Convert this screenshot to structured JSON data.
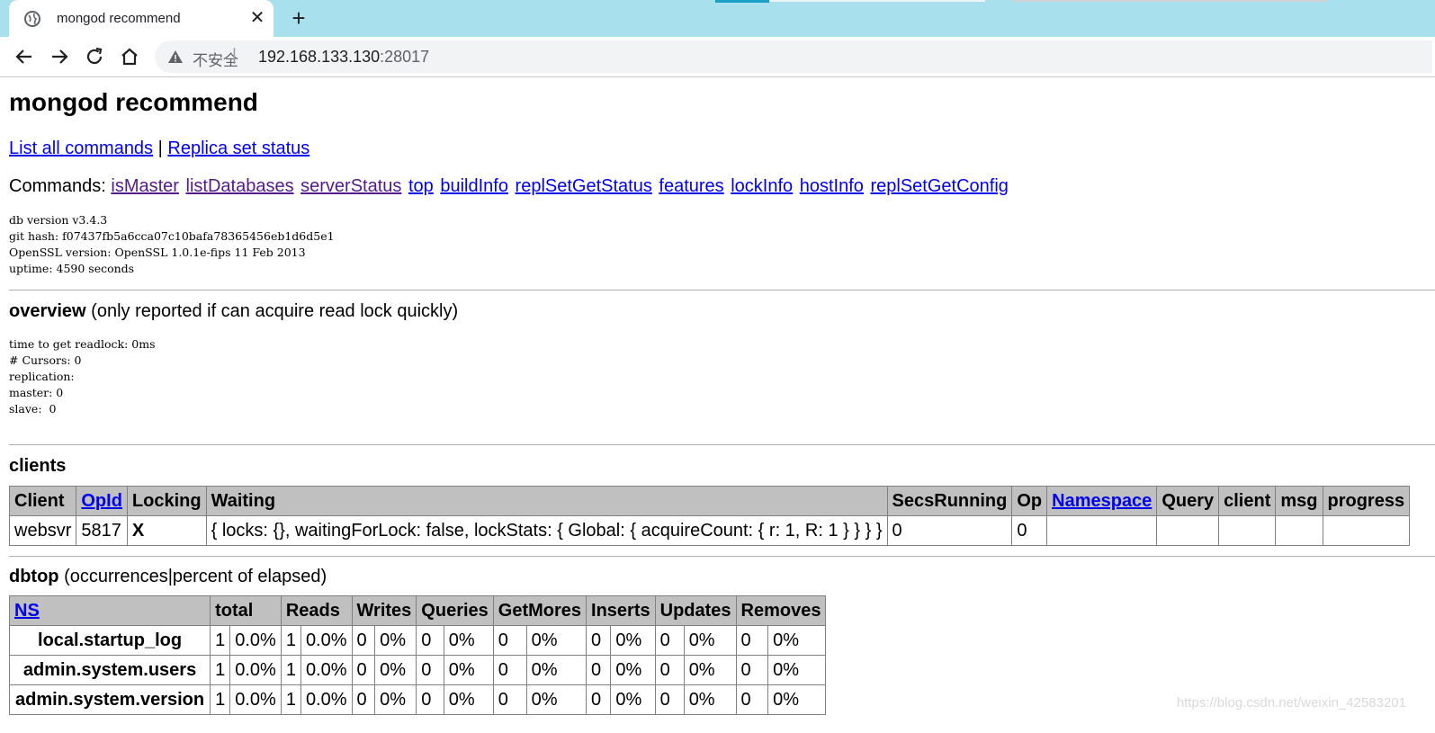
{
  "browser": {
    "tab_title": "mongod recommend",
    "new_tab_label": "+",
    "security_label": "不安全",
    "separator": "|",
    "url_host": "192.168.133.130",
    "url_port": ":28017"
  },
  "page": {
    "title": "mongod recommend",
    "nav": {
      "list_all_commands": "List all commands",
      "pipe": "|",
      "replica_set_status": "Replica set status"
    },
    "commands_label": "Commands:",
    "commands": [
      "isMaster",
      "listDatabases",
      "serverStatus",
      "top",
      "buildInfo",
      "replSetGetStatus",
      "features",
      "lockInfo",
      "hostInfo",
      "replSetGetConfig"
    ],
    "version_info": "db version v3.4.3\ngit hash: f07437fb5a6cca07c10bafa78365456eb1d6d5e1\nOpenSSL version: OpenSSL 1.0.1e-fips 11 Feb 2013\nuptime: 4590 seconds",
    "overview": {
      "title": "overview",
      "note": "(only reported if can acquire read lock quickly)",
      "details": "time to get readlock: 0ms\n# Cursors: 0\nreplication:\nmaster: 0\nslave:  0"
    },
    "clients": {
      "title": "clients",
      "headers": [
        "Client",
        "OpId",
        "Locking",
        "Waiting",
        "SecsRunning",
        "Op",
        "Namespace",
        "Query",
        "client",
        "msg",
        "progress"
      ],
      "rows": [
        [
          "websvr",
          "5817",
          "X",
          "{ locks: {}, waitingForLock: false, lockStats: { Global: { acquireCount: { r: 1, R: 1 } } } }",
          "0",
          "0",
          "",
          "",
          "",
          "",
          ""
        ]
      ]
    },
    "dbtop": {
      "title": "dbtop",
      "note": "(occurrences|percent of elapsed)",
      "headers": [
        "NS",
        "total",
        "Reads",
        "Writes",
        "Queries",
        "GetMores",
        "Inserts",
        "Updates",
        "Removes"
      ],
      "rows": [
        [
          "local.startup_log",
          "1",
          "0.0%",
          "1",
          "0.0%",
          "0",
          "0%",
          "0",
          "0%",
          "0",
          "0%",
          "0",
          "0%",
          "0",
          "0%",
          "0",
          "0%"
        ],
        [
          "admin.system.users",
          "1",
          "0.0%",
          "1",
          "0.0%",
          "0",
          "0%",
          "0",
          "0%",
          "0",
          "0%",
          "0",
          "0%",
          "0",
          "0%",
          "0",
          "0%"
        ],
        [
          "admin.system.version",
          "1",
          "0.0%",
          "1",
          "0.0%",
          "0",
          "0%",
          "0",
          "0%",
          "0",
          "0%",
          "0",
          "0%",
          "0",
          "0%",
          "0",
          "0%"
        ]
      ]
    },
    "watermark": "https://blog.csdn.net/weixin_42583201"
  },
  "colors": {
    "tabstrip": "#a8e0ee",
    "link": "#0000ee",
    "visited_link": "#551a8b",
    "table_header": "#c0c0c0"
  }
}
